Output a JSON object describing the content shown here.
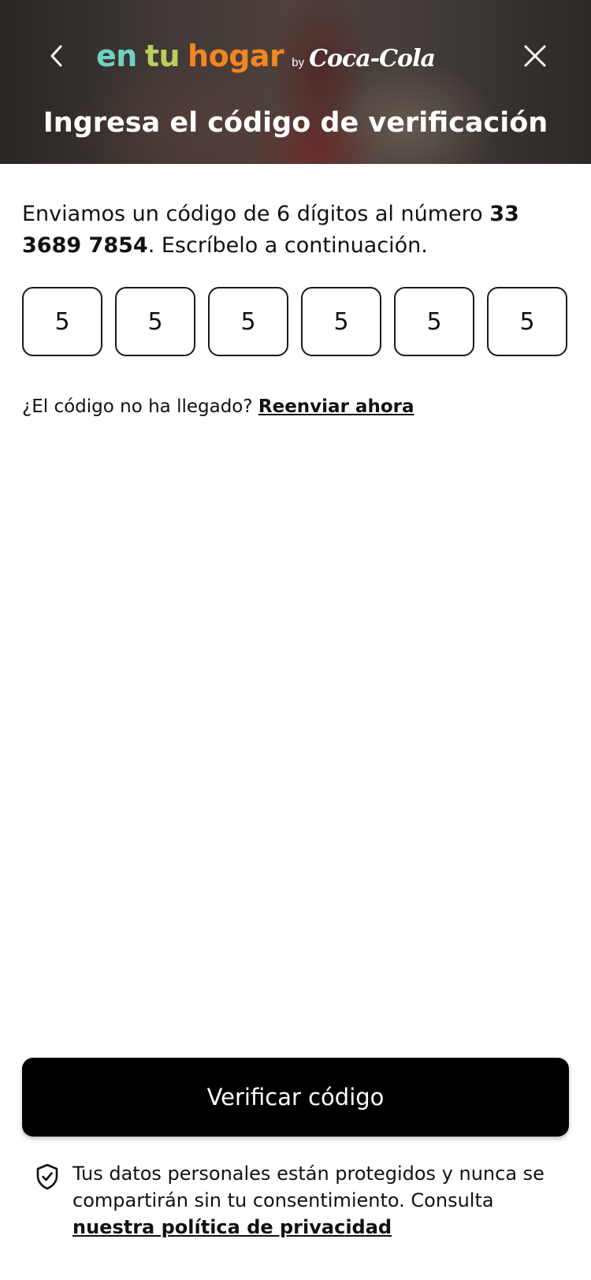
{
  "header": {
    "logo": {
      "part1": "en",
      "part2": "tu",
      "part3": "hogar",
      "by": "by",
      "brand": "Coca-Cola"
    },
    "back_icon": "chevron-left-icon",
    "close_icon": "close-icon",
    "title": "Ingresa el código de verificación"
  },
  "intro": {
    "text_before": "Enviamos un código de 6 dígitos al número",
    "phone": "33 3689 7854",
    "text_after": ". Escríbelo a continuación."
  },
  "code": {
    "digits": [
      "5",
      "5",
      "5",
      "5",
      "5",
      "5"
    ]
  },
  "resend": {
    "question": "¿El código no ha llegado?",
    "link": "Reenviar ahora"
  },
  "verify_button": {
    "label": "Verificar código"
  },
  "privacy": {
    "icon": "shield-check-icon",
    "text": "Tus datos personales están protegidos y nunca se compartirán sin tu consentimiento. Consulta",
    "link": "nuestra política de privacidad"
  },
  "colors": {
    "logo_en": "#6fd3c4",
    "logo_tu": "#b9cf5a",
    "logo_hogar": "#f48520",
    "button_bg": "#000000"
  }
}
